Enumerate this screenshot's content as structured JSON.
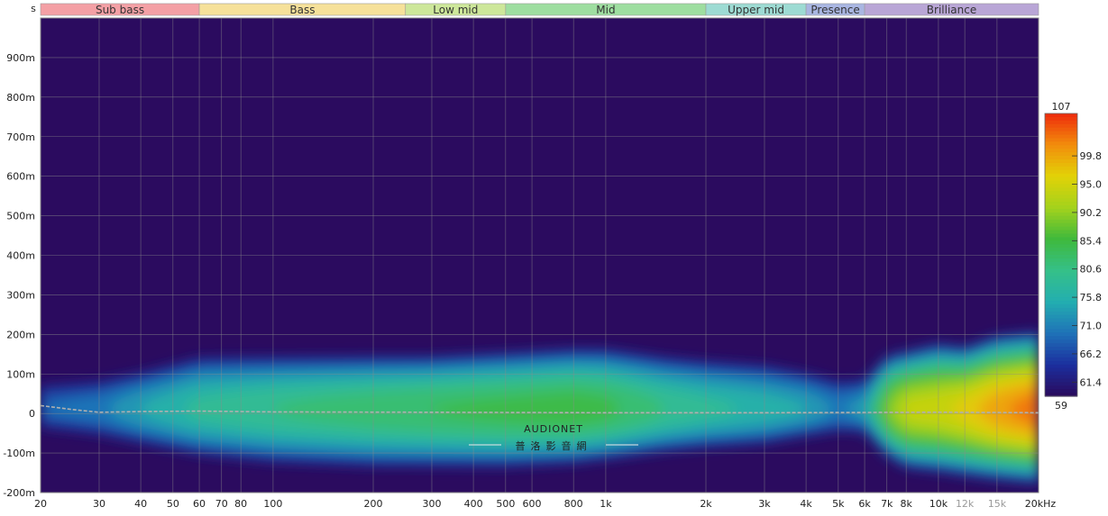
{
  "chart_data": {
    "type": "heatmap",
    "title": "",
    "xlabel": "",
    "ylabel": "s",
    "x_scale": "log",
    "x_range": [
      20,
      20000
    ],
    "x_unit": "kHz",
    "xlim": [
      20,
      20000
    ],
    "ylim": [
      -0.2,
      1.0
    ],
    "y_tick_values": [
      -0.2,
      -0.1,
      0,
      0.1,
      0.2,
      0.3,
      0.4,
      0.5,
      0.6,
      0.7,
      0.8,
      0.9
    ],
    "y_tick_labels": [
      "-200m",
      "-100m",
      "0",
      "100m",
      "200m",
      "300m",
      "400m",
      "500m",
      "600m",
      "700m",
      "800m",
      "900m"
    ],
    "x_tick_values": [
      20,
      30,
      40,
      50,
      60,
      70,
      80,
      100,
      200,
      300,
      400,
      500,
      600,
      800,
      1000,
      2000,
      3000,
      4000,
      5000,
      6000,
      7000,
      8000,
      10000,
      12000,
      15000,
      20000
    ],
    "x_tick_labels": [
      "20",
      "30",
      "40",
      "50",
      "60",
      "70",
      "80",
      "100",
      "200",
      "300",
      "400",
      "500",
      "600",
      "800",
      "1k",
      "2k",
      "3k",
      "4k",
      "5k",
      "6k",
      "7k",
      "8k",
      "10k",
      "12k",
      "15k",
      "20kHz"
    ],
    "x_dim_ticks": [
      "12k",
      "15k"
    ],
    "bands": [
      {
        "label": "Sub bass",
        "from": 20,
        "to": 60,
        "color": "#f4a0a5"
      },
      {
        "label": "Bass",
        "from": 60,
        "to": 250,
        "color": "#f6e19a"
      },
      {
        "label": "Low mid",
        "from": 250,
        "to": 500,
        "color": "#cde79a"
      },
      {
        "label": "Mid",
        "from": 500,
        "to": 2000,
        "color": "#9edea0"
      },
      {
        "label": "Upper mid",
        "from": 2000,
        "to": 4000,
        "color": "#9ddbd3"
      },
      {
        "label": "Presence",
        "from": 4000,
        "to": 6000,
        "color": "#a9b6e2"
      },
      {
        "label": "Brilliance",
        "from": 6000,
        "to": 20000,
        "color": "#b9a6d6"
      }
    ],
    "colorbar": {
      "min": 59,
      "max": 107,
      "tick_values": [
        99.8,
        95.0,
        90.2,
        85.4,
        80.6,
        75.8,
        71.0,
        66.2,
        61.4
      ],
      "tick_labels": [
        "99.8",
        "95.0",
        "90.2",
        "85.4",
        "80.6",
        "75.8",
        "71.0",
        "66.2",
        "61.4"
      ],
      "min_label": "59",
      "max_label": "107",
      "colors": [
        "#2a0a5c",
        "#1b2f9e",
        "#1f72b8",
        "#23aeb0",
        "#35c088",
        "#3fb93c",
        "#a4d21c",
        "#e2d207",
        "#f28c0c",
        "#ee2a0c"
      ]
    },
    "background_color": "#2b0b5f",
    "grid": true,
    "series": [
      {
        "kind": "energy_envelope",
        "freq_hz": [
          20,
          30,
          40,
          60,
          100,
          200,
          300,
          500,
          800,
          1000,
          1500,
          2000,
          3000,
          4000,
          5000,
          6000,
          7000,
          8000,
          10000,
          12000,
          15000,
          20000
        ],
        "extent_top_s": [
          0.09,
          0.1,
          0.12,
          0.16,
          0.16,
          0.16,
          0.16,
          0.17,
          0.18,
          0.18,
          0.16,
          0.15,
          0.14,
          0.12,
          0.1,
          0.1,
          0.16,
          0.17,
          0.19,
          0.18,
          0.21,
          0.22
        ],
        "extent_bottom_s": [
          -0.05,
          -0.07,
          -0.09,
          -0.12,
          -0.14,
          -0.15,
          -0.15,
          -0.15,
          -0.14,
          -0.13,
          -0.11,
          -0.1,
          -0.09,
          -0.07,
          -0.06,
          -0.06,
          -0.12,
          -0.15,
          -0.16,
          -0.17,
          -0.18,
          -0.19
        ],
        "peak_level": [
          70,
          72,
          76,
          80,
          82,
          84,
          85,
          86,
          87,
          86,
          82,
          80,
          78,
          76,
          72,
          75,
          90,
          95,
          96,
          98,
          102,
          105
        ]
      },
      {
        "kind": "group_delay_line",
        "color": "#b0b0b0",
        "x": [
          20,
          25,
          30,
          40,
          60,
          100,
          300,
          1000,
          3000,
          10000,
          20000
        ],
        "y": [
          0.02,
          0.01,
          0.003,
          0.005,
          0.006,
          0.004,
          0.003,
          0.002,
          0.002,
          0.003,
          0.002
        ]
      }
    ]
  },
  "watermark": {
    "title": "AUDIONET",
    "subtitle": "普洛影音網"
  }
}
